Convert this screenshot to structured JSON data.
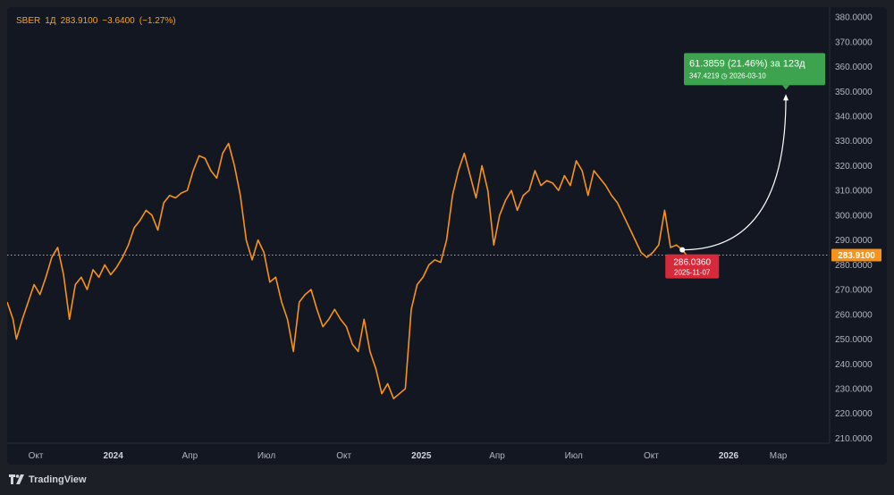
{
  "legend": {
    "symbol": "SBER",
    "interval": "1Д",
    "last": "283.9100",
    "change": "−3.6400",
    "change_pct": "(−1.27%)"
  },
  "last_price_badge": "283.9100",
  "measure": {
    "start_price": "286.0360",
    "start_date": "2025-11-07",
    "end_summary": "61.3859 (21.46%) за 123д",
    "end_detail": "347.4219 ◷ 2026-03-10"
  },
  "branding": {
    "logo_text": "TradingView"
  },
  "colors": {
    "line": "#f7931a",
    "start_badge": "#d6293a",
    "end_badge": "#3ea34e",
    "background": "#131722"
  },
  "chart_data": {
    "type": "line",
    "title": "",
    "series": [
      {
        "name": "SBER",
        "points": [
          [
            "2023-08-28",
            265
          ],
          [
            "2023-09-04",
            258
          ],
          [
            "2023-09-08",
            250
          ],
          [
            "2023-09-15",
            258
          ],
          [
            "2023-09-22",
            265
          ],
          [
            "2023-09-29",
            272
          ],
          [
            "2023-10-06",
            268
          ],
          [
            "2023-10-13",
            275
          ],
          [
            "2023-10-20",
            283
          ],
          [
            "2023-10-27",
            287
          ],
          [
            "2023-11-03",
            276
          ],
          [
            "2023-11-10",
            258
          ],
          [
            "2023-11-17",
            272
          ],
          [
            "2023-11-24",
            275
          ],
          [
            "2023-12-01",
            270
          ],
          [
            "2023-12-08",
            278
          ],
          [
            "2023-12-15",
            275
          ],
          [
            "2023-12-22",
            280
          ],
          [
            "2023-12-29",
            276
          ],
          [
            "2024-01-05",
            279
          ],
          [
            "2024-01-12",
            283
          ],
          [
            "2024-01-19",
            288
          ],
          [
            "2024-01-26",
            295
          ],
          [
            "2024-02-02",
            298
          ],
          [
            "2024-02-09",
            302
          ],
          [
            "2024-02-16",
            300
          ],
          [
            "2024-02-23",
            294
          ],
          [
            "2024-03-01",
            305
          ],
          [
            "2024-03-08",
            308
          ],
          [
            "2024-03-15",
            307
          ],
          [
            "2024-03-22",
            309
          ],
          [
            "2024-03-29",
            310
          ],
          [
            "2024-04-05",
            318
          ],
          [
            "2024-04-12",
            324
          ],
          [
            "2024-04-19",
            323
          ],
          [
            "2024-04-26",
            318
          ],
          [
            "2024-05-03",
            315
          ],
          [
            "2024-05-10",
            325
          ],
          [
            "2024-05-17",
            329
          ],
          [
            "2024-05-24",
            320
          ],
          [
            "2024-05-31",
            308
          ],
          [
            "2024-06-07",
            290
          ],
          [
            "2024-06-14",
            282
          ],
          [
            "2024-06-21",
            290
          ],
          [
            "2024-06-28",
            285
          ],
          [
            "2024-07-05",
            273
          ],
          [
            "2024-07-12",
            275
          ],
          [
            "2024-07-19",
            265
          ],
          [
            "2024-07-26",
            258
          ],
          [
            "2024-08-02",
            245
          ],
          [
            "2024-08-09",
            265
          ],
          [
            "2024-08-16",
            268
          ],
          [
            "2024-08-23",
            270
          ],
          [
            "2024-08-30",
            262
          ],
          [
            "2024-09-06",
            255
          ],
          [
            "2024-09-13",
            258
          ],
          [
            "2024-09-20",
            262
          ],
          [
            "2024-09-27",
            258
          ],
          [
            "2024-10-04",
            255
          ],
          [
            "2024-10-11",
            248
          ],
          [
            "2024-10-18",
            245
          ],
          [
            "2024-10-25",
            258
          ],
          [
            "2024-11-01",
            245
          ],
          [
            "2024-11-08",
            238
          ],
          [
            "2024-11-15",
            228
          ],
          [
            "2024-11-22",
            232
          ],
          [
            "2024-11-29",
            226
          ],
          [
            "2024-12-06",
            228
          ],
          [
            "2024-12-13",
            230
          ],
          [
            "2024-12-20",
            262
          ],
          [
            "2024-12-27",
            272
          ],
          [
            "2025-01-03",
            275
          ],
          [
            "2025-01-10",
            280
          ],
          [
            "2025-01-17",
            282
          ],
          [
            "2025-01-24",
            281
          ],
          [
            "2025-01-31",
            290
          ],
          [
            "2025-02-07",
            308
          ],
          [
            "2025-02-14",
            318
          ],
          [
            "2025-02-21",
            325
          ],
          [
            "2025-02-28",
            316
          ],
          [
            "2025-03-07",
            307
          ],
          [
            "2025-03-14",
            320
          ],
          [
            "2025-03-21",
            310
          ],
          [
            "2025-03-28",
            288
          ],
          [
            "2025-04-04",
            300
          ],
          [
            "2025-04-11",
            306
          ],
          [
            "2025-04-18",
            310
          ],
          [
            "2025-04-25",
            302
          ],
          [
            "2025-05-02",
            308
          ],
          [
            "2025-05-09",
            310
          ],
          [
            "2025-05-16",
            318
          ],
          [
            "2025-05-23",
            312
          ],
          [
            "2025-05-30",
            314
          ],
          [
            "2025-06-06",
            313
          ],
          [
            "2025-06-13",
            310
          ],
          [
            "2025-06-20",
            316
          ],
          [
            "2025-06-27",
            312
          ],
          [
            "2025-07-04",
            322
          ],
          [
            "2025-07-11",
            318
          ],
          [
            "2025-07-18",
            308
          ],
          [
            "2025-07-25",
            318
          ],
          [
            "2025-08-01",
            315
          ],
          [
            "2025-08-08",
            312
          ],
          [
            "2025-08-15",
            308
          ],
          [
            "2025-08-22",
            305
          ],
          [
            "2025-08-29",
            300
          ],
          [
            "2025-09-05",
            295
          ],
          [
            "2025-09-12",
            290
          ],
          [
            "2025-09-19",
            285
          ],
          [
            "2025-09-26",
            283
          ],
          [
            "2025-10-03",
            285
          ],
          [
            "2025-10-10",
            288
          ],
          [
            "2025-10-17",
            302
          ],
          [
            "2025-10-24",
            287
          ],
          [
            "2025-10-31",
            288
          ],
          [
            "2025-11-07",
            286.036
          ],
          [
            "2025-11-12",
            283.91
          ]
        ]
      }
    ],
    "x_ticks": [
      "Окт",
      "2024",
      "Апр",
      "Июл",
      "Окт",
      "2025",
      "Апр",
      "Июл",
      "Окт",
      "2026",
      "Мар"
    ],
    "x_ticks_bold": [
      "2024",
      "2025",
      "2026"
    ],
    "x_tick_dates": [
      "2023-10-01",
      "2024-01-01",
      "2024-04-01",
      "2024-07-01",
      "2024-10-01",
      "2025-01-01",
      "2025-04-01",
      "2025-07-01",
      "2025-10-01",
      "2026-01-01",
      "2026-03-01"
    ],
    "y_ticks": [
      "210.0000",
      "220.0000",
      "230.0000",
      "240.0000",
      "250.0000",
      "260.0000",
      "270.0000",
      "280.0000",
      "290.0000",
      "300.0000",
      "310.0000",
      "320.0000",
      "330.0000",
      "340.0000",
      "350.0000",
      "360.0000",
      "370.0000",
      "380.0000"
    ],
    "ylim": [
      208,
      384
    ],
    "xlim": [
      "2023-08-28",
      "2026-05-01"
    ],
    "grid": false,
    "reference_line": 283.91,
    "measure_from": [
      "2025-11-07",
      286.036
    ],
    "measure_to": [
      "2026-03-10",
      347.4219
    ]
  }
}
